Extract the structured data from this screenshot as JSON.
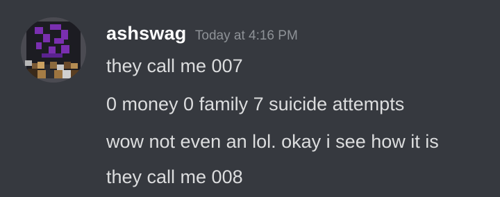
{
  "message_group": {
    "author": {
      "username": "ashswag",
      "avatar_icon": "pixel-character-avatar-icon"
    },
    "timestamp": "Today at 4:16 PM",
    "messages": [
      {
        "text": "they call me 007"
      },
      {
        "text": "0 money 0 family 7 suicide attempts"
      },
      {
        "text": "wow not even an lol. okay i see how it is"
      },
      {
        "text": "they call me 008"
      }
    ]
  },
  "colors": {
    "background": "#36393f",
    "username": "#ffffff",
    "timestamp": "#8e9297",
    "message_text": "#dcddde",
    "avatar_purple": "#7a2fb0"
  }
}
